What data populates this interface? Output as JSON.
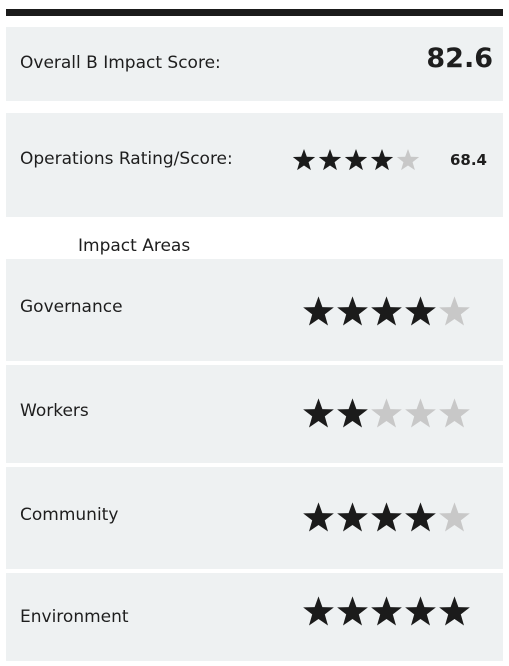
{
  "overall": {
    "label": "Overall B Impact Score:",
    "score": "82.6"
  },
  "operations": {
    "label": "Operations Rating/Score:",
    "stars_filled": 4,
    "stars_total": 5,
    "score": "68.4"
  },
  "impact_areas_heading": "Impact Areas",
  "impact_areas": [
    {
      "name": "Governance",
      "stars_filled": 4,
      "stars_total": 5
    },
    {
      "name": "Workers",
      "stars_filled": 2,
      "stars_total": 5
    },
    {
      "name": "Community",
      "stars_filled": 4,
      "stars_total": 5
    },
    {
      "name": "Environment",
      "stars_filled": 5,
      "stars_total": 5
    }
  ],
  "colors": {
    "panel_background": "#eef1f2",
    "star_filled": "#1b1b1b",
    "star_empty": "#c8c8c8",
    "text": "#1e1e1e",
    "rule": "#1b1b1b"
  }
}
